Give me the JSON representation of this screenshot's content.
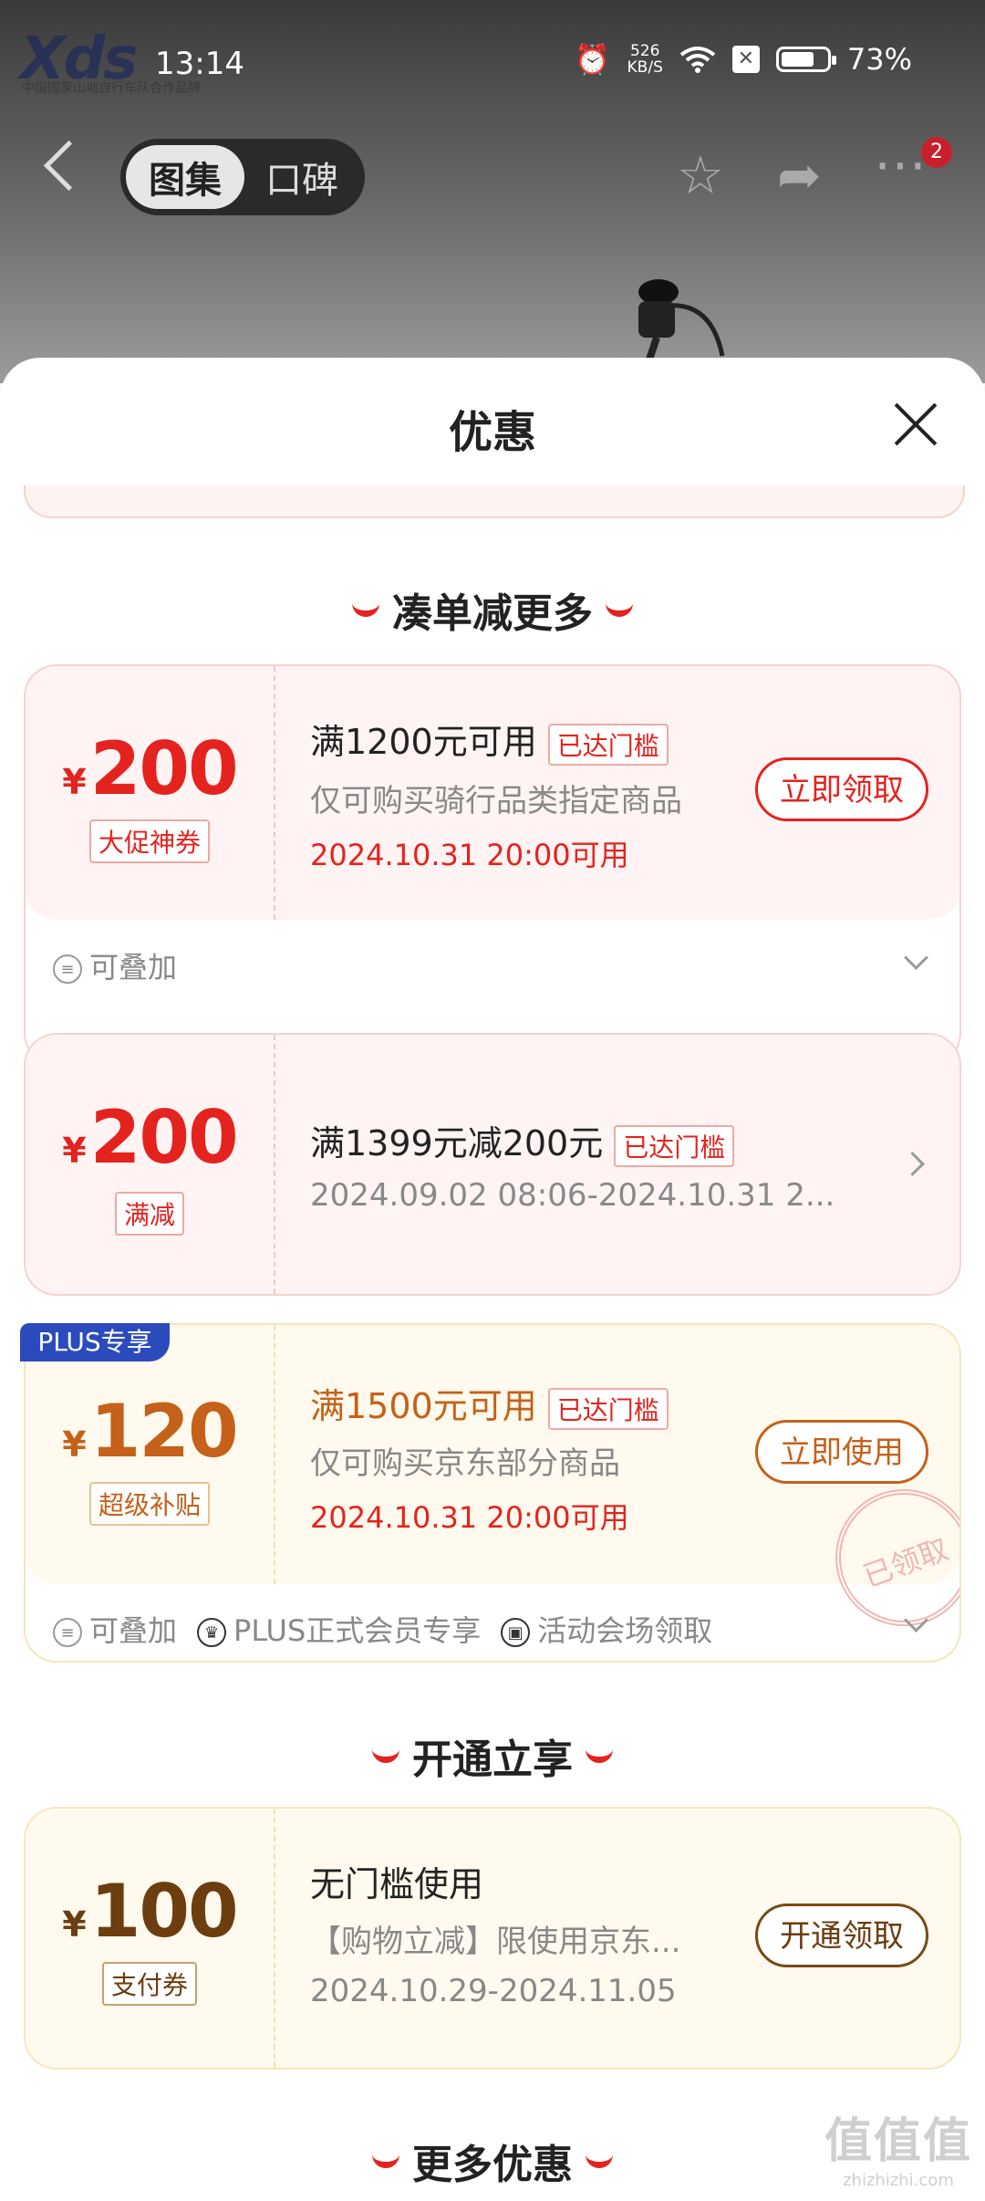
{
  "status": {
    "time": "13:14",
    "speed": "526",
    "speed_unit": "KB/S",
    "battery": "73%",
    "battery_level": 0.73
  },
  "logo": {
    "text": "Xds",
    "sub": "中国国家山地自行车队合作品牌"
  },
  "nav": {
    "tab_active": "图集",
    "tab_inactive": "口碑",
    "badge": "2"
  },
  "sheet": {
    "title": "优惠",
    "section1": "凑单减更多",
    "section2": "开通立享",
    "section3": "更多优惠"
  },
  "coupons": [
    {
      "yen": "¥",
      "amount": "200",
      "tag": "大促神券",
      "title": "满1200元可用",
      "reach": "已达门槛",
      "desc": "仅可购买骑行品类指定商品",
      "date": "2024.10.31 20:00可用",
      "button": "立即领取",
      "foot": [
        "可叠加"
      ]
    },
    {
      "yen": "¥",
      "amount": "200",
      "tag": "满减",
      "title": "满1399元减200元",
      "reach": "已达门槛",
      "date": "2024.09.02 08:06-2024.10.31 2..."
    },
    {
      "plus": "PLUS专享",
      "yen": "¥",
      "amount": "120",
      "tag": "超级补贴",
      "title": "满1500元可用",
      "reach": "已达门槛",
      "desc": "仅可购买京东部分商品",
      "date": "2024.10.31 20:00可用",
      "button": "立即使用",
      "stamp": "已领取",
      "foot": [
        "可叠加",
        "PLUS正式会员专享",
        "活动会场领取"
      ]
    },
    {
      "yen": "¥",
      "amount": "100",
      "tag": "支付券",
      "title": "无门槛使用",
      "desc": "【购物立减】限使用京东...",
      "date": "2024.10.29-2024.11.05",
      "button": "开通领取"
    }
  ],
  "watermark": {
    "title": "值值值",
    "url": "zhizhizhi.com"
  }
}
